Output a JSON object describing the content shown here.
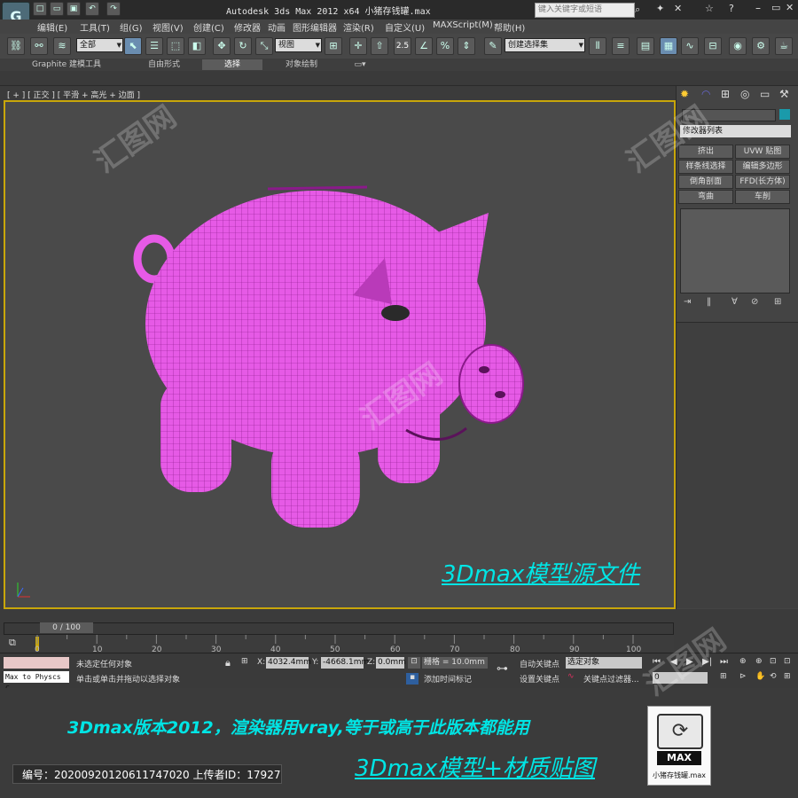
{
  "window": {
    "title": "Autodesk 3ds Max  2012 x64    小猪存钱罐.max",
    "search_placeholder": "键入关键字或短语"
  },
  "menu": [
    "编辑(E)",
    "工具(T)",
    "组(G)",
    "视图(V)",
    "创建(C)",
    "修改器",
    "动画",
    "图形编辑器",
    "渲染(R)",
    "自定义(U)",
    "MAXScript(M)",
    "帮助(H)"
  ],
  "toolbar": {
    "selection_filter": "全部",
    "reference_coord": "视图",
    "angle_snap": "2.5",
    "named_selection": "创建选择集"
  },
  "ribbon": {
    "tabs": [
      "Graphite 建模工具",
      "自由形式",
      "选择",
      "对象绘制"
    ],
    "active_tab": "选择"
  },
  "viewport": {
    "label": "[ + ] [ 正交 ] [ 平滑 + 高光 + 边面 ]",
    "model_color": "#e65ae6",
    "border_color": "#c8a60a"
  },
  "command_panel": {
    "modifier_list": "修改器列表",
    "buttons": [
      "挤出",
      "UVW 贴图",
      "样条线选择",
      "编辑多边形",
      "倒角剖面",
      "FFD(长方体)",
      "弯曲",
      "车削"
    ]
  },
  "timeline": {
    "frame": "0 / 100",
    "ticks": [
      "0",
      "10",
      "20",
      "30",
      "40",
      "50",
      "60",
      "70",
      "80",
      "90",
      "100"
    ]
  },
  "status": {
    "selection": "未选定任何对象",
    "prompt": "单击或单击并拖动以选择对象",
    "script": "Max to Physcs C",
    "x": "4032.4mm",
    "y": "-4668.1mm",
    "z": "0.0mm",
    "grid": "栅格 = 10.0mm",
    "add_time_tag": "添加时间标记",
    "auto_key": "自动关键点",
    "set_key": "设置关键点",
    "selected_object": "选定对象",
    "key_filters": "关键点过滤器...",
    "frame_field": "0"
  },
  "captions": {
    "source": "3Dmax模型源文件",
    "version": "3Dmax版本2012，渲染器用vray,等于或高于此版本都能用",
    "material": "3Dmax模型+材质贴图"
  },
  "id_bar": "编号：20200920120611747020 上传者ID：17927",
  "file_icon": {
    "badge": "MAX",
    "filename": "小猪存钱罐.max"
  },
  "watermark": "汇图网"
}
